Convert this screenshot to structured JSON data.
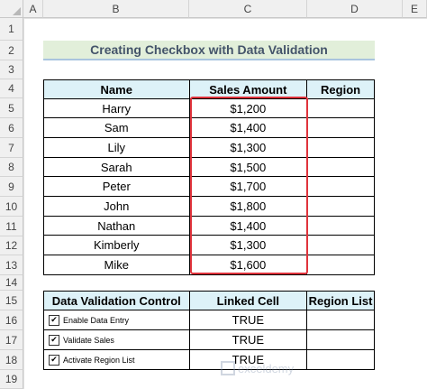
{
  "columns": [
    "A",
    "B",
    "C",
    "D",
    "E"
  ],
  "rows": [
    "1",
    "2",
    "3",
    "4",
    "5",
    "6",
    "7",
    "8",
    "9",
    "10",
    "11",
    "12",
    "13",
    "14",
    "15",
    "16",
    "17",
    "18",
    "19"
  ],
  "title": "Creating Checkbox with Data Validation",
  "sales_table": {
    "headers": [
      "Name",
      "Sales Amount",
      "Region"
    ],
    "rows": [
      {
        "name": "Harry",
        "amount": "$1,200",
        "region": ""
      },
      {
        "name": "Sam",
        "amount": "$1,400",
        "region": ""
      },
      {
        "name": "Lily",
        "amount": "$1,300",
        "region": ""
      },
      {
        "name": "Sarah",
        "amount": "$1,500",
        "region": ""
      },
      {
        "name": "Peter",
        "amount": "$1,700",
        "region": ""
      },
      {
        "name": "John",
        "amount": "$1,800",
        "region": ""
      },
      {
        "name": "Nathan",
        "amount": "$1,400",
        "region": ""
      },
      {
        "name": "Kimberly",
        "amount": "$1,300",
        "region": ""
      },
      {
        "name": "Mike",
        "amount": "$1,600",
        "region": ""
      }
    ]
  },
  "control_table": {
    "headers": [
      "Data Validation Control",
      "Linked Cell",
      "Region List"
    ],
    "rows": [
      {
        "checkbox_label": "Enable Data Entry",
        "checked": true,
        "linked": "TRUE",
        "region_list": ""
      },
      {
        "checkbox_label": "Validate Sales",
        "checked": true,
        "linked": "TRUE",
        "region_list": ""
      },
      {
        "checkbox_label": "Activate Region List",
        "checked": true,
        "linked": "TRUE",
        "region_list": ""
      }
    ]
  },
  "checkmark_glyph": "✔",
  "watermark": "exceldemy",
  "colors": {
    "title_bg": "#e2efda",
    "header_bg": "#ddf2f8",
    "highlight": "#e0333c"
  }
}
